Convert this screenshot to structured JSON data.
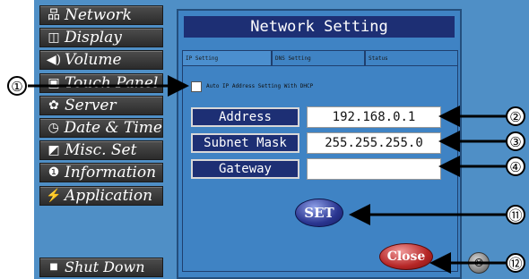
{
  "menu": {
    "items": [
      {
        "label": "Network",
        "icon": "network-icon",
        "glyph": "品"
      },
      {
        "label": "Display",
        "icon": "display-icon",
        "glyph": "◫"
      },
      {
        "label": "Volume",
        "icon": "speaker-icon",
        "glyph": "◀)"
      },
      {
        "label": "Touch Panel",
        "icon": "touch-panel-icon",
        "glyph": "▣"
      },
      {
        "label": "Server",
        "icon": "server-icon",
        "glyph": "✿"
      },
      {
        "label": "Date & Time",
        "icon": "clock-icon",
        "glyph": "◷"
      },
      {
        "label": "Misc. Set",
        "icon": "misc-icon",
        "glyph": "◩"
      },
      {
        "label": "Information",
        "icon": "info-icon",
        "glyph": "❶"
      },
      {
        "label": "Application",
        "icon": "bolt-icon",
        "glyph": "⚡"
      }
    ],
    "shutdown": {
      "label": "Shut Down",
      "icon": "power-icon",
      "glyph": "■"
    }
  },
  "dialog": {
    "title": "Network Setting",
    "tabs": [
      "IP Setting",
      "DNS Setting",
      "Status"
    ],
    "dhcp_label": "Auto IP Address Setting With DHCP",
    "fields": [
      {
        "label": "Address",
        "value": "192.168.0.1"
      },
      {
        "label": "Subnet Mask",
        "value": "255.255.255.0"
      },
      {
        "label": "Gateway",
        "value": ""
      }
    ],
    "set_label": "SET",
    "close_label": "Close"
  },
  "callouts": [
    "①",
    "②",
    "③",
    "④",
    "⑪",
    "⑫"
  ],
  "colors": {
    "frame": "#4f8fc6",
    "title_bar": "#1d2f74",
    "set_button": "#2a3590",
    "close_button": "#b52626"
  }
}
